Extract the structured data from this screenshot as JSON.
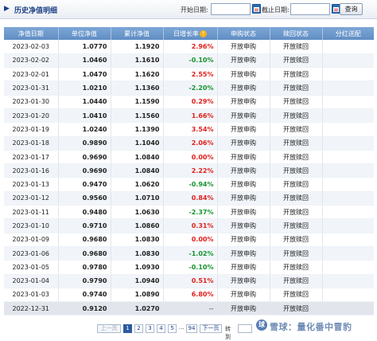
{
  "header": {
    "arrow": "▶",
    "title": "历史净值明细",
    "start_label": "开始日期:",
    "end_label": "截止日期:",
    "start_value": "",
    "end_value": "",
    "query_label": "查询"
  },
  "table": {
    "columns": [
      "净值日期",
      "单位净值",
      "累计净值",
      "日增长率",
      "申购状态",
      "赎回状态",
      "分红送配"
    ],
    "help_glyph": "?",
    "rows": [
      {
        "date": "2023-02-03",
        "nav": "1.0770",
        "acc": "1.1920",
        "growth": "2.96%",
        "dir": "up",
        "buy": "开放申购",
        "redeem": "开放赎回",
        "div": ""
      },
      {
        "date": "2023-02-02",
        "nav": "1.0460",
        "acc": "1.1610",
        "growth": "-0.10%",
        "dir": "down",
        "buy": "开放申购",
        "redeem": "开放赎回",
        "div": ""
      },
      {
        "date": "2023-02-01",
        "nav": "1.0470",
        "acc": "1.1620",
        "growth": "2.55%",
        "dir": "up",
        "buy": "开放申购",
        "redeem": "开放赎回",
        "div": ""
      },
      {
        "date": "2023-01-31",
        "nav": "1.0210",
        "acc": "1.1360",
        "growth": "-2.20%",
        "dir": "down",
        "buy": "开放申购",
        "redeem": "开放赎回",
        "div": ""
      },
      {
        "date": "2023-01-30",
        "nav": "1.0440",
        "acc": "1.1590",
        "growth": "0.29%",
        "dir": "up",
        "buy": "开放申购",
        "redeem": "开放赎回",
        "div": ""
      },
      {
        "date": "2023-01-20",
        "nav": "1.0410",
        "acc": "1.1560",
        "growth": "1.66%",
        "dir": "up",
        "buy": "开放申购",
        "redeem": "开放赎回",
        "div": ""
      },
      {
        "date": "2023-01-19",
        "nav": "1.0240",
        "acc": "1.1390",
        "growth": "3.54%",
        "dir": "up",
        "buy": "开放申购",
        "redeem": "开放赎回",
        "div": ""
      },
      {
        "date": "2023-01-18",
        "nav": "0.9890",
        "acc": "1.1040",
        "growth": "2.06%",
        "dir": "up",
        "buy": "开放申购",
        "redeem": "开放赎回",
        "div": ""
      },
      {
        "date": "2023-01-17",
        "nav": "0.9690",
        "acc": "1.0840",
        "growth": "0.00%",
        "dir": "up",
        "buy": "开放申购",
        "redeem": "开放赎回",
        "div": ""
      },
      {
        "date": "2023-01-16",
        "nav": "0.9690",
        "acc": "1.0840",
        "growth": "2.22%",
        "dir": "up",
        "buy": "开放申购",
        "redeem": "开放赎回",
        "div": ""
      },
      {
        "date": "2023-01-13",
        "nav": "0.9470",
        "acc": "1.0620",
        "growth": "-0.94%",
        "dir": "down",
        "buy": "开放申购",
        "redeem": "开放赎回",
        "div": ""
      },
      {
        "date": "2023-01-12",
        "nav": "0.9560",
        "acc": "1.0710",
        "growth": "0.84%",
        "dir": "up",
        "buy": "开放申购",
        "redeem": "开放赎回",
        "div": ""
      },
      {
        "date": "2023-01-11",
        "nav": "0.9480",
        "acc": "1.0630",
        "growth": "-2.37%",
        "dir": "down",
        "buy": "开放申购",
        "redeem": "开放赎回",
        "div": ""
      },
      {
        "date": "2023-01-10",
        "nav": "0.9710",
        "acc": "1.0860",
        "growth": "0.31%",
        "dir": "up",
        "buy": "开放申购",
        "redeem": "开放赎回",
        "div": ""
      },
      {
        "date": "2023-01-09",
        "nav": "0.9680",
        "acc": "1.0830",
        "growth": "0.00%",
        "dir": "up",
        "buy": "开放申购",
        "redeem": "开放赎回",
        "div": ""
      },
      {
        "date": "2023-01-06",
        "nav": "0.9680",
        "acc": "1.0830",
        "growth": "-1.02%",
        "dir": "down",
        "buy": "开放申购",
        "redeem": "开放赎回",
        "div": ""
      },
      {
        "date": "2023-01-05",
        "nav": "0.9780",
        "acc": "1.0930",
        "growth": "-0.10%",
        "dir": "down",
        "buy": "开放申购",
        "redeem": "开放赎回",
        "div": ""
      },
      {
        "date": "2023-01-04",
        "nav": "0.9790",
        "acc": "1.0940",
        "growth": "0.51%",
        "dir": "up",
        "buy": "开放申购",
        "redeem": "开放赎回",
        "div": ""
      },
      {
        "date": "2023-01-03",
        "nav": "0.9740",
        "acc": "1.0890",
        "growth": "6.80%",
        "dir": "up",
        "buy": "开放申购",
        "redeem": "开放赎回",
        "div": ""
      },
      {
        "date": "2022-12-31",
        "nav": "0.9120",
        "acc": "1.0270",
        "growth": "--",
        "dir": "flat",
        "buy": "开放申购",
        "redeem": "开放赎回",
        "div": ""
      }
    ]
  },
  "pager": {
    "prev": "上一页",
    "pages": [
      "1",
      "2",
      "3",
      "4",
      "5"
    ],
    "current": "1",
    "ellipsis": "...",
    "last": "94",
    "next": "下一页",
    "goto": "转到",
    "goto_value": ""
  },
  "watermark": {
    "logo": "球",
    "text": "雪球：量化番中冒豹"
  },
  "colors": {
    "up": "#e0211c",
    "down": "#17932e",
    "header": "#5f8dc4",
    "accent": "#2c5aa0"
  }
}
